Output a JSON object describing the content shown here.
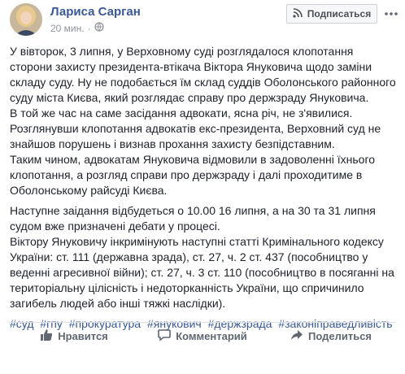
{
  "post": {
    "author_name": "Лариса Сарган",
    "time": "20 мин.",
    "subscribe_label": "Подписаться",
    "paragraphs": [
      [
        "У вівторок, 3 липня, у Верховному суді розглядалося клопотання",
        "сторони захисту президента-втікача Віктора Януковича щодо заміни",
        "складу суду. Ну не подобається їм склад суддів Оболонського районного",
        "суду міста Києва, який розглядає справу про держзраду Януковича.",
        "В той же час на саме засідання адвокати, ясна річ, не з'явилися.",
        "Розглянувши клопотання адвокатів екс-президента, Верховний суд не",
        "знайшов порушень і визнав прохання захисту безпідставним.",
        "Таким чином, адвокатам Януковича відмовили в задоволенні їхнього",
        "клопотання, а розгляд справи про держзраду і далі проходитиме в",
        "Оболонському райсуді Києва."
      ],
      [
        "Наступне заідання відбудеться о 10.00 16 липня, а на 30 та 31 липня",
        "судом вже призначені дебати у процесі.",
        "Віктору Януковичу інкримінують наступні статті Кримінального кодексу",
        "України: ст. 111 (державна зрада), ст. 27, ч. 2 ст. 437 (пособництво у",
        "веденні агресивної війни); ст. 27, ч. 3 ст. 110 (пособництво в посяганні на",
        "територіальну цілісність і недоторканність України, що спричинило",
        "загибель людей або інші тяжкі наслідки)."
      ]
    ],
    "hashtags": [
      "#суд",
      "#гпу",
      "#прокуратура",
      "#янукович",
      "#держзрада",
      "#законіправедливість"
    ]
  },
  "actions": {
    "like_label": "Нравится",
    "comment_label": "Комментарий",
    "share_label": "Поделиться"
  },
  "colors": {
    "link": "#365899",
    "author": "#385898",
    "secondary_text": "#90949c"
  }
}
